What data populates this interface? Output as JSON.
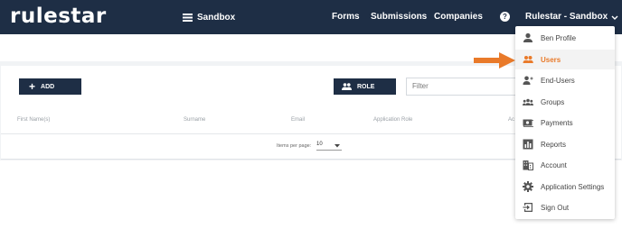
{
  "header": {
    "logo": "rulestar",
    "environment": "Sandbox",
    "nav": [
      "Forms",
      "Submissions",
      "Companies"
    ],
    "help_glyph": "?",
    "account_label": "Rulestar - Sandbox"
  },
  "toolbar": {
    "add_label": "ADD",
    "role_label": "ROLE",
    "filter_placeholder": "Filter"
  },
  "table": {
    "columns": [
      "First Name(s)",
      "Surname",
      "Email",
      "Application Role",
      "Ac"
    ]
  },
  "pager": {
    "items_per_page_label": "Items per page:",
    "items_per_page_value": "10"
  },
  "menu": {
    "items": [
      {
        "label": "Ben Profile",
        "icon": "person-icon"
      },
      {
        "label": "Users",
        "icon": "people-icon",
        "active": true
      },
      {
        "label": "End-Users",
        "icon": "end-users-icon"
      },
      {
        "label": "Groups",
        "icon": "groups-icon"
      },
      {
        "label": "Payments",
        "icon": "payments-icon"
      },
      {
        "label": "Reports",
        "icon": "reports-icon"
      },
      {
        "label": "Account",
        "icon": "building-icon"
      },
      {
        "label": "Application Settings",
        "icon": "gear-icon"
      },
      {
        "label": "Sign Out",
        "icon": "sign-out-icon"
      }
    ]
  },
  "colors": {
    "navbar": "#1e2e45",
    "accent": "#e97a2a",
    "icon_gray": "#555555"
  }
}
